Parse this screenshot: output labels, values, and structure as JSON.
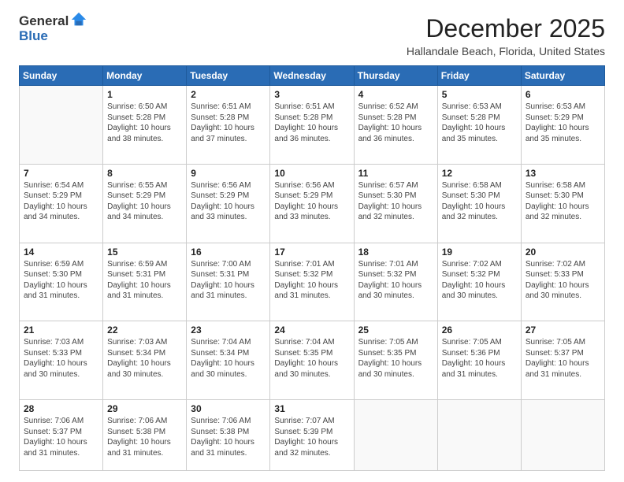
{
  "logo": {
    "general": "General",
    "blue": "Blue"
  },
  "title": "December 2025",
  "location": "Hallandale Beach, Florida, United States",
  "days": [
    "Sunday",
    "Monday",
    "Tuesday",
    "Wednesday",
    "Thursday",
    "Friday",
    "Saturday"
  ],
  "weeks": [
    [
      {
        "num": "",
        "text": ""
      },
      {
        "num": "1",
        "text": "Sunrise: 6:50 AM\nSunset: 5:28 PM\nDaylight: 10 hours\nand 38 minutes."
      },
      {
        "num": "2",
        "text": "Sunrise: 6:51 AM\nSunset: 5:28 PM\nDaylight: 10 hours\nand 37 minutes."
      },
      {
        "num": "3",
        "text": "Sunrise: 6:51 AM\nSunset: 5:28 PM\nDaylight: 10 hours\nand 36 minutes."
      },
      {
        "num": "4",
        "text": "Sunrise: 6:52 AM\nSunset: 5:28 PM\nDaylight: 10 hours\nand 36 minutes."
      },
      {
        "num": "5",
        "text": "Sunrise: 6:53 AM\nSunset: 5:28 PM\nDaylight: 10 hours\nand 35 minutes."
      },
      {
        "num": "6",
        "text": "Sunrise: 6:53 AM\nSunset: 5:29 PM\nDaylight: 10 hours\nand 35 minutes."
      }
    ],
    [
      {
        "num": "7",
        "text": "Sunrise: 6:54 AM\nSunset: 5:29 PM\nDaylight: 10 hours\nand 34 minutes."
      },
      {
        "num": "8",
        "text": "Sunrise: 6:55 AM\nSunset: 5:29 PM\nDaylight: 10 hours\nand 34 minutes."
      },
      {
        "num": "9",
        "text": "Sunrise: 6:56 AM\nSunset: 5:29 PM\nDaylight: 10 hours\nand 33 minutes."
      },
      {
        "num": "10",
        "text": "Sunrise: 6:56 AM\nSunset: 5:29 PM\nDaylight: 10 hours\nand 33 minutes."
      },
      {
        "num": "11",
        "text": "Sunrise: 6:57 AM\nSunset: 5:30 PM\nDaylight: 10 hours\nand 32 minutes."
      },
      {
        "num": "12",
        "text": "Sunrise: 6:58 AM\nSunset: 5:30 PM\nDaylight: 10 hours\nand 32 minutes."
      },
      {
        "num": "13",
        "text": "Sunrise: 6:58 AM\nSunset: 5:30 PM\nDaylight: 10 hours\nand 32 minutes."
      }
    ],
    [
      {
        "num": "14",
        "text": "Sunrise: 6:59 AM\nSunset: 5:30 PM\nDaylight: 10 hours\nand 31 minutes."
      },
      {
        "num": "15",
        "text": "Sunrise: 6:59 AM\nSunset: 5:31 PM\nDaylight: 10 hours\nand 31 minutes."
      },
      {
        "num": "16",
        "text": "Sunrise: 7:00 AM\nSunset: 5:31 PM\nDaylight: 10 hours\nand 31 minutes."
      },
      {
        "num": "17",
        "text": "Sunrise: 7:01 AM\nSunset: 5:32 PM\nDaylight: 10 hours\nand 31 minutes."
      },
      {
        "num": "18",
        "text": "Sunrise: 7:01 AM\nSunset: 5:32 PM\nDaylight: 10 hours\nand 30 minutes."
      },
      {
        "num": "19",
        "text": "Sunrise: 7:02 AM\nSunset: 5:32 PM\nDaylight: 10 hours\nand 30 minutes."
      },
      {
        "num": "20",
        "text": "Sunrise: 7:02 AM\nSunset: 5:33 PM\nDaylight: 10 hours\nand 30 minutes."
      }
    ],
    [
      {
        "num": "21",
        "text": "Sunrise: 7:03 AM\nSunset: 5:33 PM\nDaylight: 10 hours\nand 30 minutes."
      },
      {
        "num": "22",
        "text": "Sunrise: 7:03 AM\nSunset: 5:34 PM\nDaylight: 10 hours\nand 30 minutes."
      },
      {
        "num": "23",
        "text": "Sunrise: 7:04 AM\nSunset: 5:34 PM\nDaylight: 10 hours\nand 30 minutes."
      },
      {
        "num": "24",
        "text": "Sunrise: 7:04 AM\nSunset: 5:35 PM\nDaylight: 10 hours\nand 30 minutes."
      },
      {
        "num": "25",
        "text": "Sunrise: 7:05 AM\nSunset: 5:35 PM\nDaylight: 10 hours\nand 30 minutes."
      },
      {
        "num": "26",
        "text": "Sunrise: 7:05 AM\nSunset: 5:36 PM\nDaylight: 10 hours\nand 31 minutes."
      },
      {
        "num": "27",
        "text": "Sunrise: 7:05 AM\nSunset: 5:37 PM\nDaylight: 10 hours\nand 31 minutes."
      }
    ],
    [
      {
        "num": "28",
        "text": "Sunrise: 7:06 AM\nSunset: 5:37 PM\nDaylight: 10 hours\nand 31 minutes."
      },
      {
        "num": "29",
        "text": "Sunrise: 7:06 AM\nSunset: 5:38 PM\nDaylight: 10 hours\nand 31 minutes."
      },
      {
        "num": "30",
        "text": "Sunrise: 7:06 AM\nSunset: 5:38 PM\nDaylight: 10 hours\nand 31 minutes."
      },
      {
        "num": "31",
        "text": "Sunrise: 7:07 AM\nSunset: 5:39 PM\nDaylight: 10 hours\nand 32 minutes."
      },
      {
        "num": "",
        "text": ""
      },
      {
        "num": "",
        "text": ""
      },
      {
        "num": "",
        "text": ""
      }
    ]
  ]
}
